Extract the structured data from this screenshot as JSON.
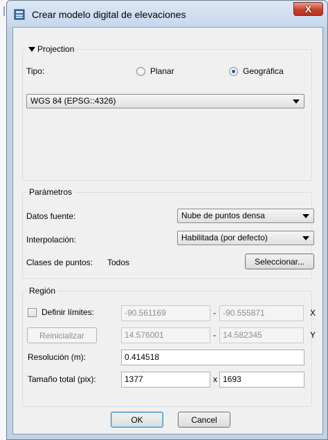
{
  "window": {
    "title": "Crear modelo digital de elevaciones",
    "close_label": "X"
  },
  "projection": {
    "group_label": "Projection",
    "tipo_label": "Tipo:",
    "planar_label": "Planar",
    "geografica_label": "Geográfica",
    "selected": "Geográfica",
    "crs_value": "WGS 84 (EPSG::4326)"
  },
  "parametros": {
    "group_label": "Parámetros",
    "datos_fuente_label": "Datos fuente:",
    "datos_fuente_value": "Nube de puntos densa",
    "interpolacion_label": "Interpolación:",
    "interpolacion_value": "Habilitada (por defecto)",
    "clases_label": "Clases de puntos:",
    "clases_value": "Todos",
    "seleccionar_label": "Seleccionar..."
  },
  "region": {
    "group_label": "Región",
    "definir_label": "Definir límites:",
    "definir_checked": false,
    "x_min": "-90.561169",
    "x_max": "-90.555871",
    "x_axis": "X",
    "y_min": "14.576001",
    "y_max": "14.582345",
    "y_axis": "Y",
    "dash": "-",
    "reinicializar_label": "Reinicializar",
    "resolucion_label": "Resolución (m):",
    "resolucion_value": "0.414518",
    "tamano_label": "Tamaño total (pix):",
    "tamano_w": "1377",
    "tamano_x": "x",
    "tamano_h": "1693"
  },
  "buttons": {
    "ok": "OK",
    "cancel": "Cancel"
  },
  "colors": {
    "titlebar": "#c7d8ec",
    "close": "#c8412c",
    "dialog_bg": "#f0f0f0",
    "radio_selected": "#1f5fa8"
  }
}
